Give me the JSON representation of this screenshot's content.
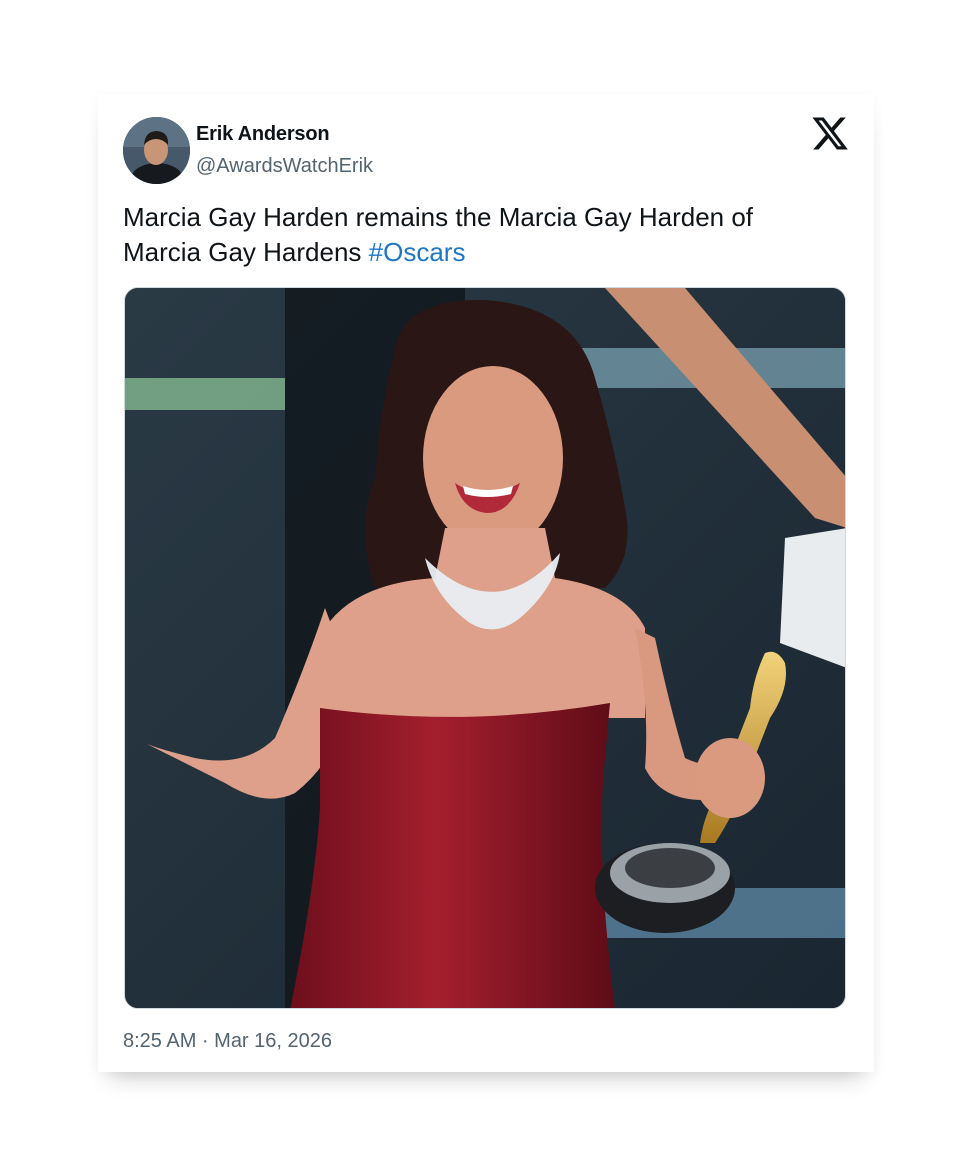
{
  "tweet": {
    "author": {
      "display_name": "Erik Anderson",
      "handle": "@AwardsWatchErik",
      "avatar_icon": "profile-photo"
    },
    "text_parts": {
      "body": "Marcia Gay Harden remains the Marcia Gay Harden of Marcia Gay Hardens ",
      "hashtag": "#Oscars"
    },
    "media": {
      "type": "photo",
      "description_icon": "photo-image"
    },
    "timestamp": "8:25 AM · Mar 16, 2026",
    "platform_icon": "x-logo-icon"
  },
  "colors": {
    "text": "#0f1419",
    "secondary": "#536471",
    "hashtag": "#1d76c7",
    "border": "#cfd9de"
  }
}
